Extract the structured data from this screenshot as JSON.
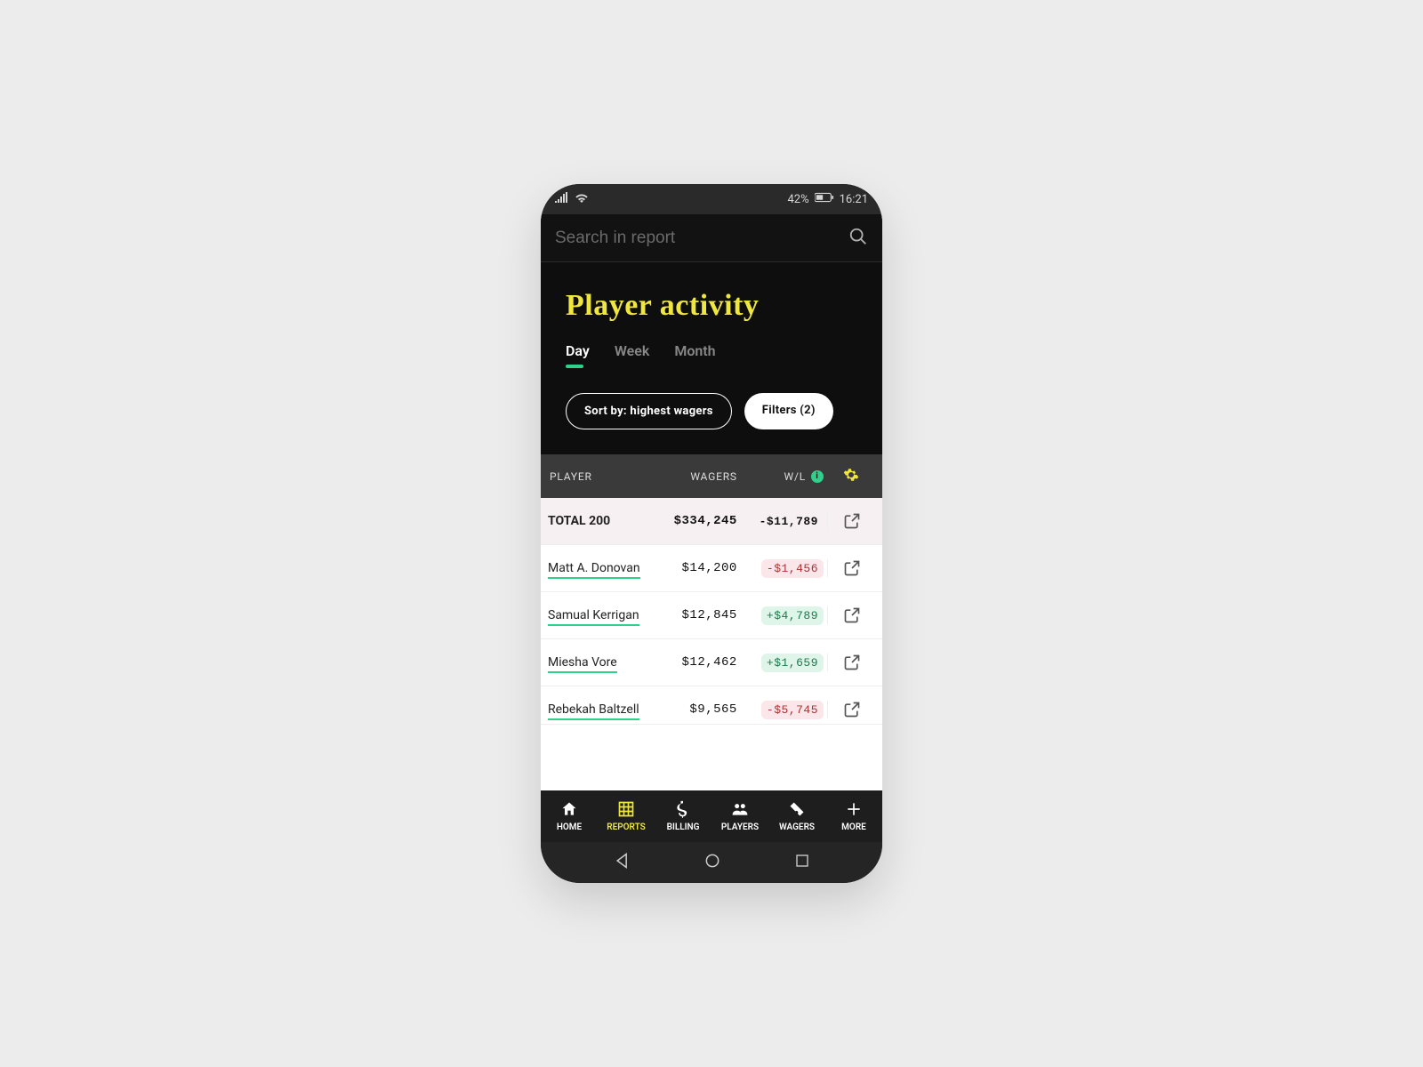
{
  "statusbar": {
    "battery": "42%",
    "time": "16:21"
  },
  "search": {
    "placeholder": "Search in report"
  },
  "header": {
    "title": "Player activity",
    "tabs": [
      "Day",
      "Week",
      "Month"
    ],
    "active_tab_index": 0,
    "sort_label": "Sort by: highest wagers",
    "filters_label": "Filters (2)"
  },
  "columns": {
    "player": "PLAYER",
    "wagers": "WAGERS",
    "wl": "W/L"
  },
  "total_row": {
    "label": "TOTAL 200",
    "wagers": "$334,245",
    "wl": "-$11,789"
  },
  "rows": [
    {
      "name": "Matt A. Donovan",
      "wagers": "$14,200",
      "wl": "-$1,456",
      "sign": "neg"
    },
    {
      "name": "Samual Kerrigan",
      "wagers": "$12,845",
      "wl": "+$4,789",
      "sign": "pos"
    },
    {
      "name": "Miesha Vore",
      "wagers": "$12,462",
      "wl": "+$1,659",
      "sign": "pos"
    },
    {
      "name": "Rebekah Baltzell",
      "wagers": "$9,565",
      "wl": "-$5,745",
      "sign": "neg"
    }
  ],
  "nav": [
    {
      "label": "HOME"
    },
    {
      "label": "REPORTS"
    },
    {
      "label": "BILLING"
    },
    {
      "label": "PLAYERS"
    },
    {
      "label": "WAGERS"
    },
    {
      "label": "MORE"
    }
  ],
  "nav_active_index": 1
}
